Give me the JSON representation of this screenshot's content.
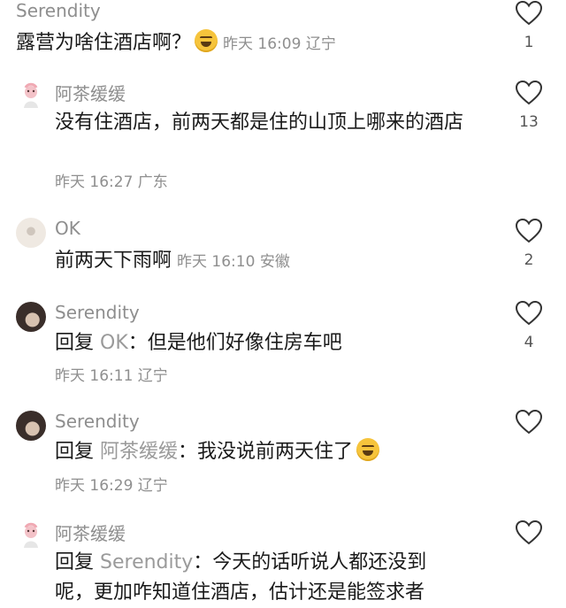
{
  "comments": [
    {
      "name": "Serendity",
      "text": "露营为啥住酒店啊？",
      "emoji": "grinning-sweat-emoji",
      "time": "昨天 16:09 辽宁",
      "likes": "1"
    },
    {
      "name": "阿茶缓缓",
      "text": "没有住酒店，前两天都是住的山顶上哪来的酒店",
      "time": "昨天 16:27 广东",
      "likes": "13"
    },
    {
      "name": "OK",
      "text": "前两天下雨啊",
      "time": "昨天 16:10 安徽",
      "likes": "2"
    },
    {
      "name": "Serendity",
      "reply_word": "回复",
      "reply_to": "OK",
      "text": "：但是他们好像住房车吧",
      "time": "昨天 16:11 辽宁",
      "likes": "4"
    },
    {
      "name": "Serendity",
      "reply_word": "回复",
      "reply_to": "阿茶缓缓",
      "text": "：我没说前两天住了",
      "emoji": "grinning-sweat-emoji",
      "time": "昨天 16:29 辽宁",
      "likes": ""
    },
    {
      "name": "阿茶缓缓",
      "reply_word": "回复",
      "reply_to": "Serendity",
      "text": "：今天的话听说人都还没到",
      "text2": "呢，更加咋知道住酒店，估计还是能签求者",
      "likes": ""
    }
  ]
}
